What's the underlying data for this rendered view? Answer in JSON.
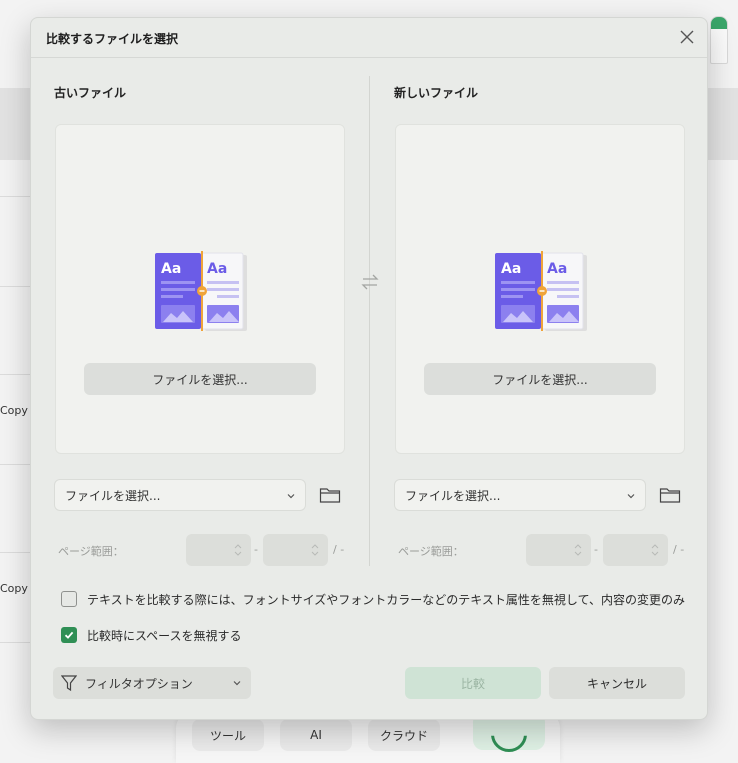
{
  "background": {
    "copy_labels": [
      "Copy",
      "Copy"
    ],
    "toolbar": [
      {
        "label": "ツール"
      },
      {
        "label": "AI"
      },
      {
        "label": "クラウド"
      }
    ]
  },
  "dialog": {
    "title": "比較するファイルを選択",
    "close_icon": "close-icon",
    "old_file": {
      "title": "古いファイル",
      "choose_label": "ファイルを選択...",
      "select_value": "ファイルを選択...",
      "page_range_label": "ページ範囲：",
      "range_sep": "-",
      "total_sep": "/ -"
    },
    "new_file": {
      "title": "新しいファイル",
      "choose_label": "ファイルを選択...",
      "select_value": "ファイルを選択...",
      "page_range_label": "ページ範囲：",
      "range_sep": "-",
      "total_sep": "/ -"
    },
    "illustration_text": "Aa",
    "options": {
      "ignore_attributes": {
        "label": "テキストを比較する際には、フォントサイズやフォントカラーなどのテキスト属性を無視して、内容の変更のみ",
        "checked": false
      },
      "ignore_spaces": {
        "label": "比較時にスペースを無視する",
        "checked": true
      }
    },
    "filter_label": "フィルタオプション",
    "compare_label": "比較",
    "cancel_label": "キャンセル"
  },
  "colors": {
    "accent_green": "#2f8f55",
    "illustration_purple": "#6b5ce7",
    "illustration_orange": "#f0a43a"
  }
}
